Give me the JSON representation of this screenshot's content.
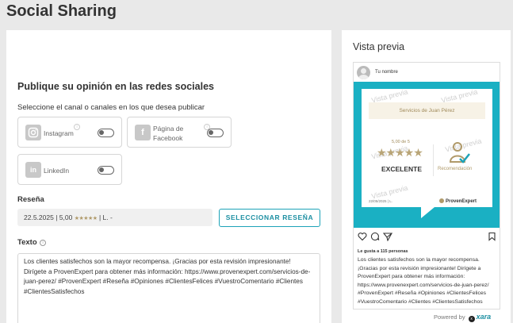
{
  "page": {
    "title": "Social Sharing"
  },
  "form": {
    "heading": "Publique su opinión en las redes sociales",
    "channels_prompt": "Seleccione el canal o canales en los que desea publicar",
    "channels": [
      {
        "name": "Instagram",
        "icon": "instagram-icon",
        "label": "Instagram"
      },
      {
        "name": "Facebook",
        "icon": "facebook-icon",
        "label_line1": "Página de",
        "label_line2": "Facebook"
      },
      {
        "name": "LinkedIn",
        "icon": "linkedin-icon",
        "label": "LinkedIn"
      }
    ],
    "review_label": "Reseña",
    "review_date": "22.5.2025",
    "review_score": "5,00",
    "review_stars": "★★★★★",
    "review_author": "L. -",
    "select_review_button": "SELECCIONAR RESEÑA",
    "text_label": "Texto",
    "text_value": "Los clientes satisfechos son la mayor recompensa. ¡Gracias por esta revisión impresionante! Dirígete a ProvenExpert para obtener más información: https://www.provenexpert.com/servicios-de-juan-perez/ #ProvenExpert #Reseña #Opiniones #ClientesFelices #VuestroComentario #Clientes #ClientesSatisfechos"
  },
  "preview": {
    "title": "Vista previa",
    "user_name": "Tu nombre",
    "watermark": "Vista previa",
    "card": {
      "service": "Servicios de Juan Pérez",
      "score": "5,00 de 5",
      "stars": "★★★★★",
      "rating_word": "EXCELENTE",
      "recommendation": "Recomendación",
      "date": "22/05/2025 | L.",
      "logo": "ProvenExpert"
    },
    "likes": "Le gusta a 115 personas",
    "caption": "Los clientes satisfechos son la mayor recompensa. ¡Gracias por esta revisión impresionante! Dirígete a ProvenExpert para obtener más información: https://www.provenexpert.com/servicios-de-juan-perez/ #ProvenExpert #Reseña #Opiniones #ClientesFelices #VuestroComentario #Clientes #ClientesSatisfechos",
    "powered_by": "Powered by",
    "powered_brand": "xara"
  },
  "colors": {
    "accent": "#1da3b8",
    "gold": "#b09a6a",
    "instagram_bg": "#1ab0c3"
  }
}
